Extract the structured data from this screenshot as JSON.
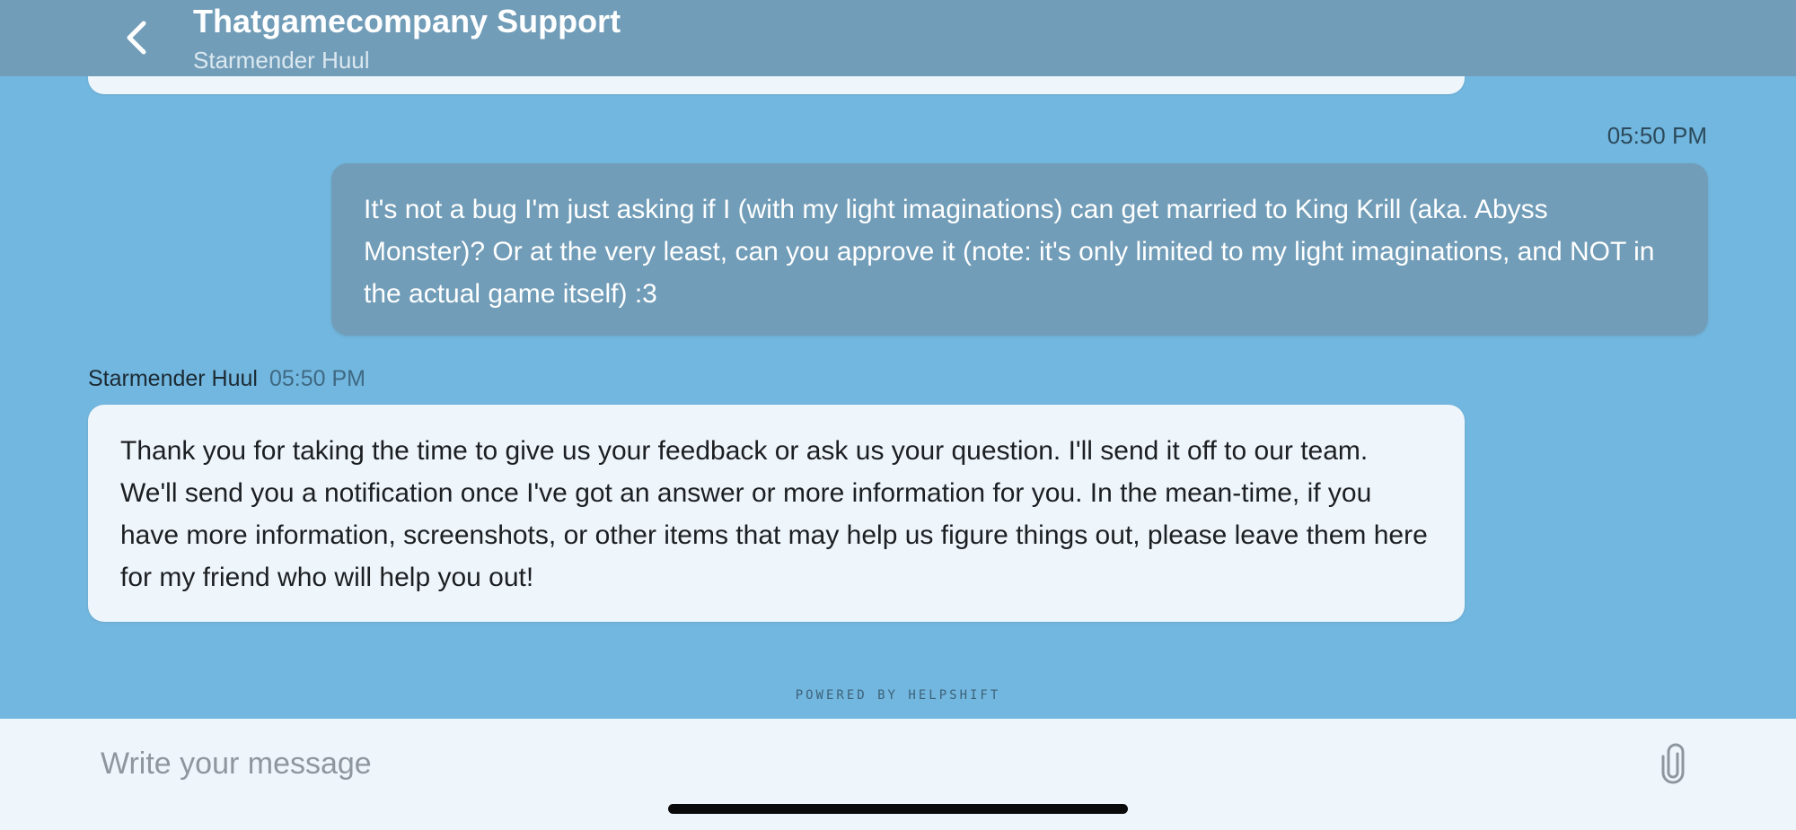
{
  "header": {
    "title": "Thatgamecompany Support",
    "subtitle": "Starmender Huul",
    "back_icon": "chevron-left-icon"
  },
  "messages": [
    {
      "direction": "outgoing",
      "time": "05:50 PM",
      "text": "It's not a bug I'm just asking if I (with my light imaginations) can get married to King Krill (aka. Abyss Monster)? Or at the very least, can you approve it (note: it's only limited to my light imaginations, and NOT in the actual game itself) :3"
    },
    {
      "direction": "incoming",
      "sender": "Starmender Huul",
      "time": "05:50 PM",
      "text": "Thank you for taking the time to give us your feedback or ask us your question. I'll send it off to our team. We'll send you a notification once I've got an answer or more information for you. In the mean-time, if you have more information, screenshots, or other items that may help us figure things out, please leave them here for my friend who will help you out!"
    }
  ],
  "footer": {
    "powered_by": "POWERED BY HELPSHIFT"
  },
  "composer": {
    "placeholder": "Write your message",
    "value": "",
    "attach_icon": "paperclip-icon"
  },
  "colors": {
    "background": "#72b7df",
    "header": "#719db8",
    "outgoing_bubble": "#719db8",
    "incoming_bubble": "#eef5fb",
    "composer": "#eef5fb"
  }
}
